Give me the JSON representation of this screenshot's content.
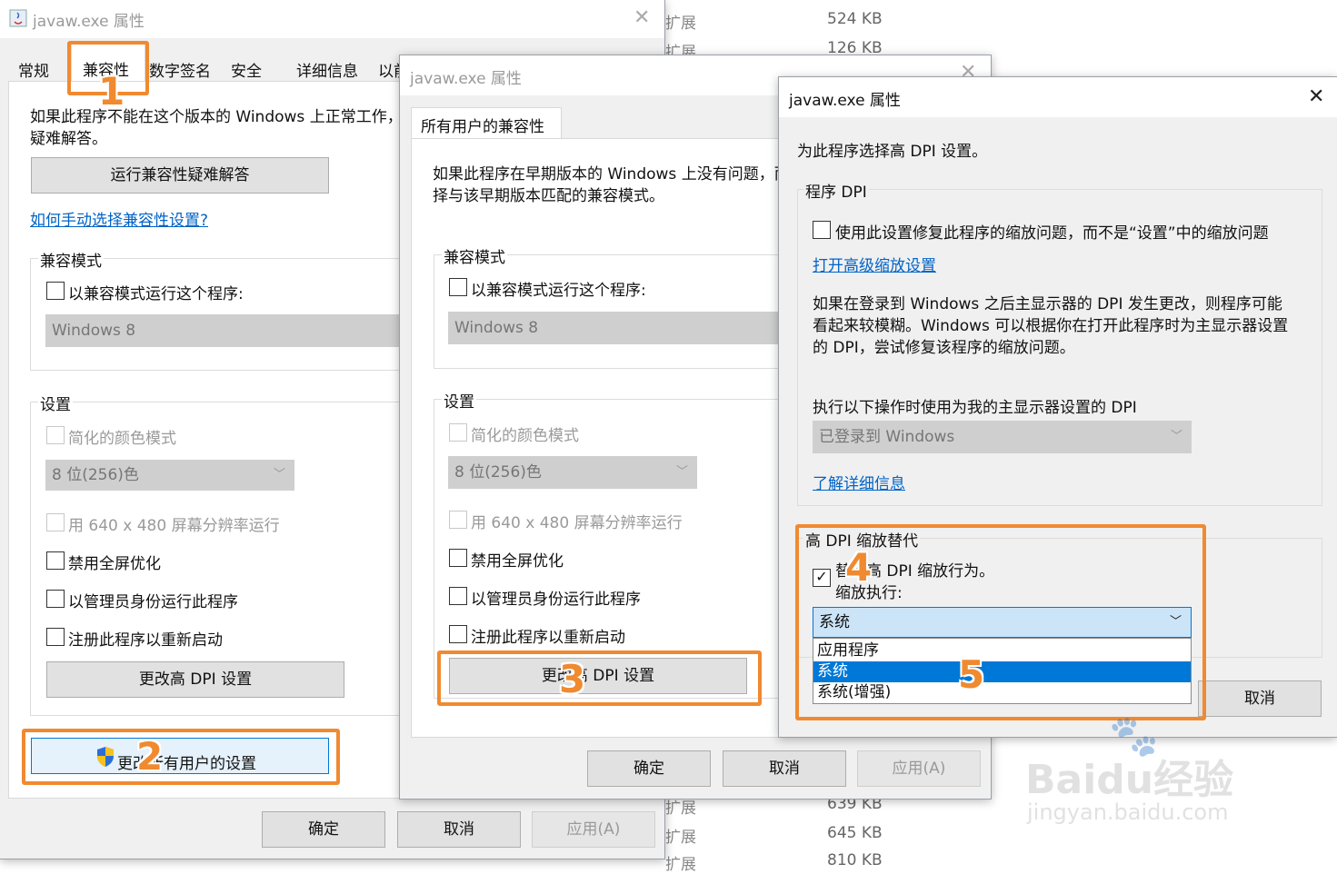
{
  "background_list": {
    "rows": [
      {
        "type": "扩展",
        "size": "524 KB"
      },
      {
        "type": "扩展",
        "size": "126 KB"
      },
      {
        "type": "扩展",
        "size": "639 KB"
      },
      {
        "type": "扩展",
        "size": "645 KB"
      },
      {
        "type": "扩展",
        "size": "810 KB"
      }
    ]
  },
  "win1": {
    "title": "javaw.exe 属性",
    "tabs": [
      "常规",
      "兼容性",
      "数字签名",
      "安全",
      "详细信息",
      "以前的版本"
    ],
    "intro": "如果此程序不能在这个版本的 Windows 上正常工作，请尝试运行兼容性疑难解答。",
    "intro_line2": "疑难解答。",
    "troubleshoot_button": "运行兼容性疑难解答",
    "manual_link": "如何手动选择兼容性设置?",
    "compat_group": "兼容模式",
    "compat_checkbox": "以兼容模式运行这个程序:",
    "compat_select": "Windows 8",
    "settings_group": "设置",
    "reduced_color": "简化的颜色模式",
    "color_select": "8 位(256)色",
    "res640": "用 640 x 480 屏幕分辨率运行",
    "disable_fullscreen": "禁用全屏优化",
    "run_as_admin": "以管理员身份运行此程序",
    "register_restart": "注册此程序以重新启动",
    "change_dpi": "更改高 DPI 设置",
    "all_users": "更改所有用户的设置",
    "ok": "确定",
    "cancel": "取消",
    "apply": "应用(A)"
  },
  "win2": {
    "title": "javaw.exe 属性",
    "tab": "所有用户的兼容性",
    "intro_line1": "如果此程序在早期版本的 Windows 上没有问题，而现在出现问题，请选",
    "intro_line2": "择与该早期版本匹配的兼容模式。",
    "compat_group": "兼容模式",
    "compat_checkbox": "以兼容模式运行这个程序:",
    "compat_select": "Windows 8",
    "settings_group": "设置",
    "reduced_color": "简化的颜色模式",
    "color_select": "8 位(256)色",
    "res640": "用 640 x 480 屏幕分辨率运行",
    "disable_fullscreen": "禁用全屏优化",
    "run_as_admin": "以管理员身份运行此程序",
    "register_restart": "注册此程序以重新启动",
    "change_dpi": "更改高 DPI 设置",
    "ok": "确定",
    "cancel": "取消",
    "apply": "应用(A)"
  },
  "win3": {
    "title": "javaw.exe 属性",
    "heading": "为此程序选择高 DPI 设置。",
    "program_dpi_group": "程序 DPI",
    "fix_scaling": "使用此设置修复此程序的缩放问题，而不是“设置”中的缩放问题",
    "advanced_link": "打开高级缩放设置",
    "desc_line1": "如果在登录到 Windows 之后主显示器的 DPI 发生更改，则程序可能",
    "desc_line2": "看起来较模糊。Windows 可以根据你在打开此程序时为主显示器设置",
    "desc_line3": "的 DPI，尝试修复该程序的缩放问题。",
    "use_dpi_label": "执行以下操作时使用为我的主显示器设置的 DPI",
    "login_select": "已登录到 Windows",
    "learn_more": "了解详细信息",
    "override_group": "高 DPI 缩放替代",
    "override_checkbox_line1": "替代高 DPI 缩放行为。",
    "override_checkbox_line2": "缩放执行:",
    "scaling_select": "系统",
    "dropdown_options": [
      "应用程序",
      "系统",
      "系统(增强)"
    ],
    "selected_option": "系统",
    "cancel": "取消"
  },
  "steps": [
    "1",
    "2",
    "3",
    "4",
    "5"
  ],
  "watermark": {
    "brand": "Baidu经验",
    "url": "jingyan.baidu.com"
  },
  "colors": {
    "highlight": "#f08a30",
    "link": "#0063c7",
    "selection": "#0078d7"
  }
}
